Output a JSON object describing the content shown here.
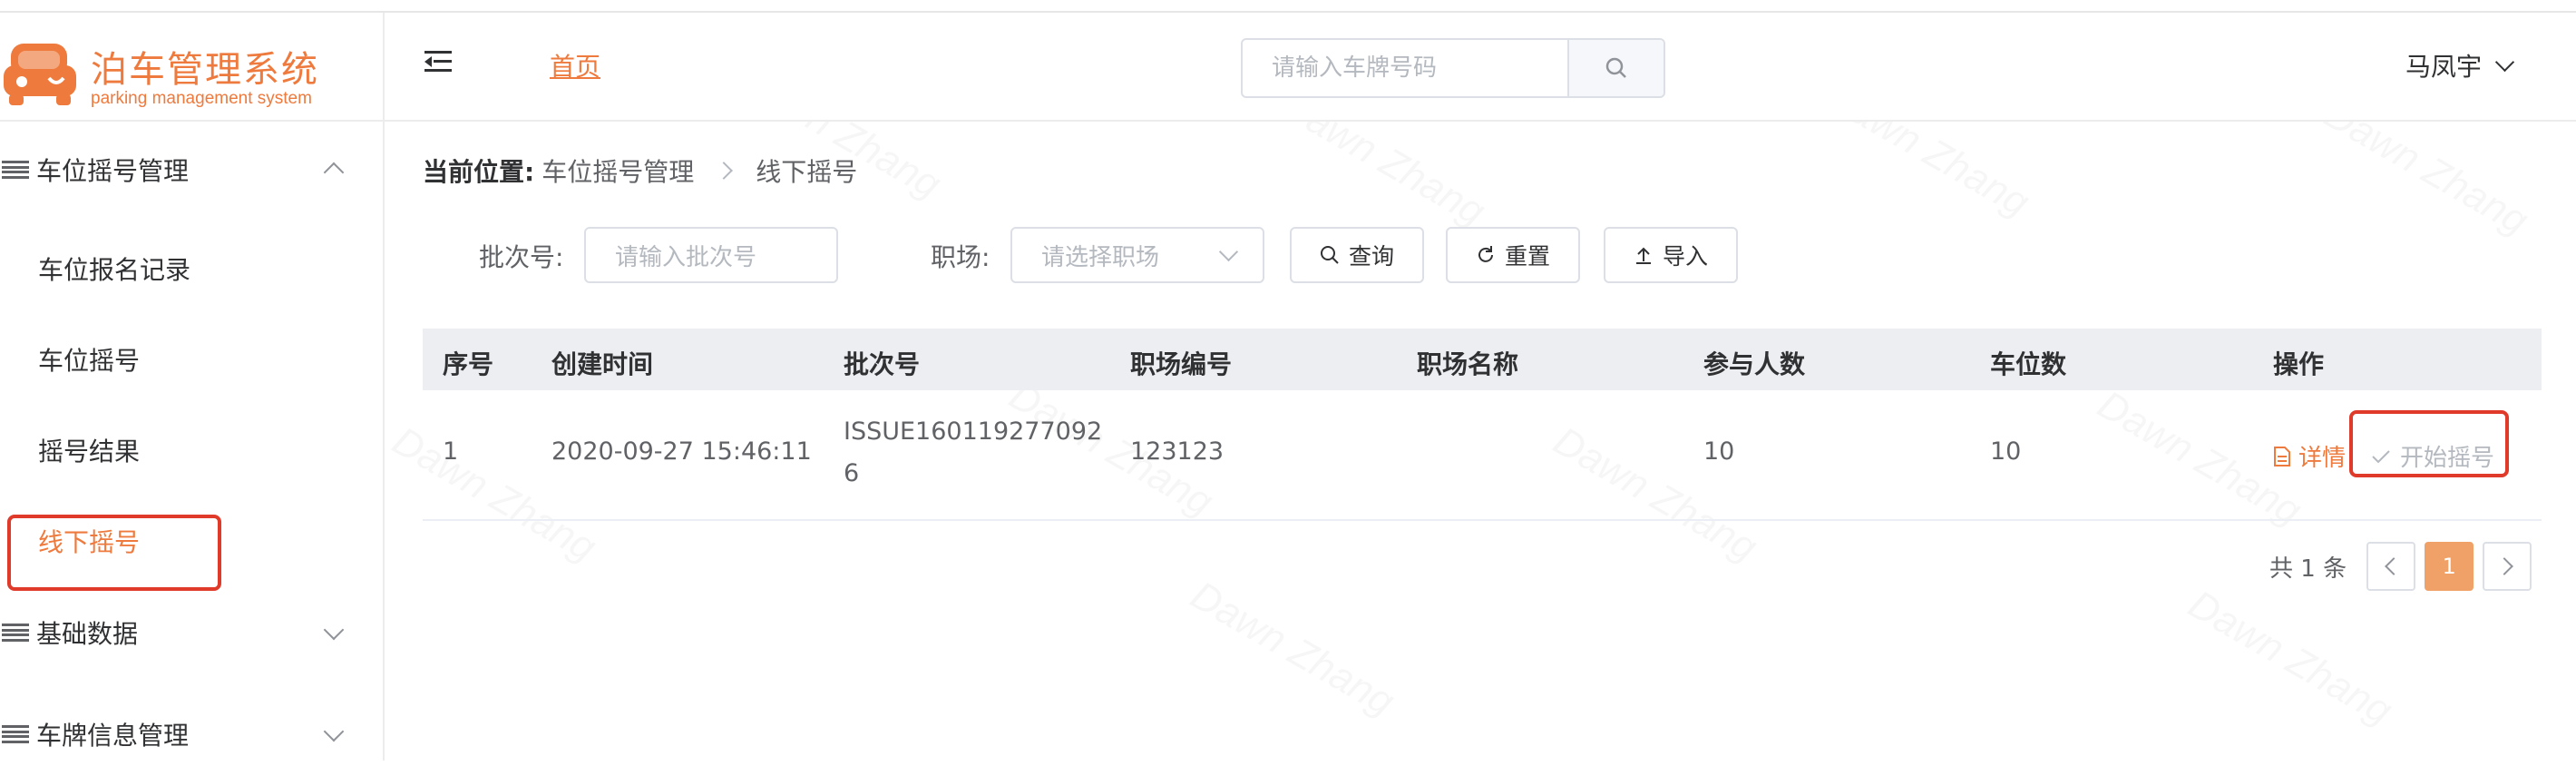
{
  "brand": {
    "title": "泊车管理系统",
    "subtitle": "parking management system",
    "accent": "#ee7a3d"
  },
  "sidebar": {
    "groups": [
      {
        "label": "车位摇号管理",
        "expanded": true
      },
      {
        "label": "基础数据",
        "expanded": false
      },
      {
        "label": "车牌信息管理",
        "expanded": false
      }
    ],
    "items": [
      {
        "label": "车位报名记录"
      },
      {
        "label": "车位摇号"
      },
      {
        "label": "摇号结果"
      },
      {
        "label": "线下摇号",
        "active": true
      }
    ]
  },
  "header": {
    "menu_icon": "menu-fold-icon",
    "home_link": "首页",
    "search_placeholder": "请输入车牌号码",
    "search_icon": "search-icon",
    "user_name": "马凤宇"
  },
  "breadcrumb": {
    "current_label": "当前位置:",
    "items": [
      "车位摇号管理",
      "线下摇号"
    ]
  },
  "filters": {
    "batch_label": "批次号:",
    "batch_placeholder": "请输入批次号",
    "venue_label": "职场:",
    "venue_placeholder": "请选择职场",
    "query_button": "查询",
    "reset_button": "重置",
    "import_button": "导入"
  },
  "table": {
    "columns": [
      "序号",
      "创建时间",
      "批次号",
      "职场编号",
      "职场名称",
      "参与人数",
      "车位数",
      "操作"
    ],
    "rows": [
      {
        "index": "1",
        "created_at": "2020-09-27 15:46:11",
        "batch_line1": "ISSUE160119277092",
        "batch_line2": "6",
        "venue_code": "123123",
        "venue_name": "",
        "participants": "10",
        "spots": "10",
        "detail_action": "详情",
        "start_action": "开始摇号"
      }
    ]
  },
  "pagination": {
    "total_text": "共 1 条",
    "current_page": "1"
  },
  "watermark": "Dawn Zhang"
}
